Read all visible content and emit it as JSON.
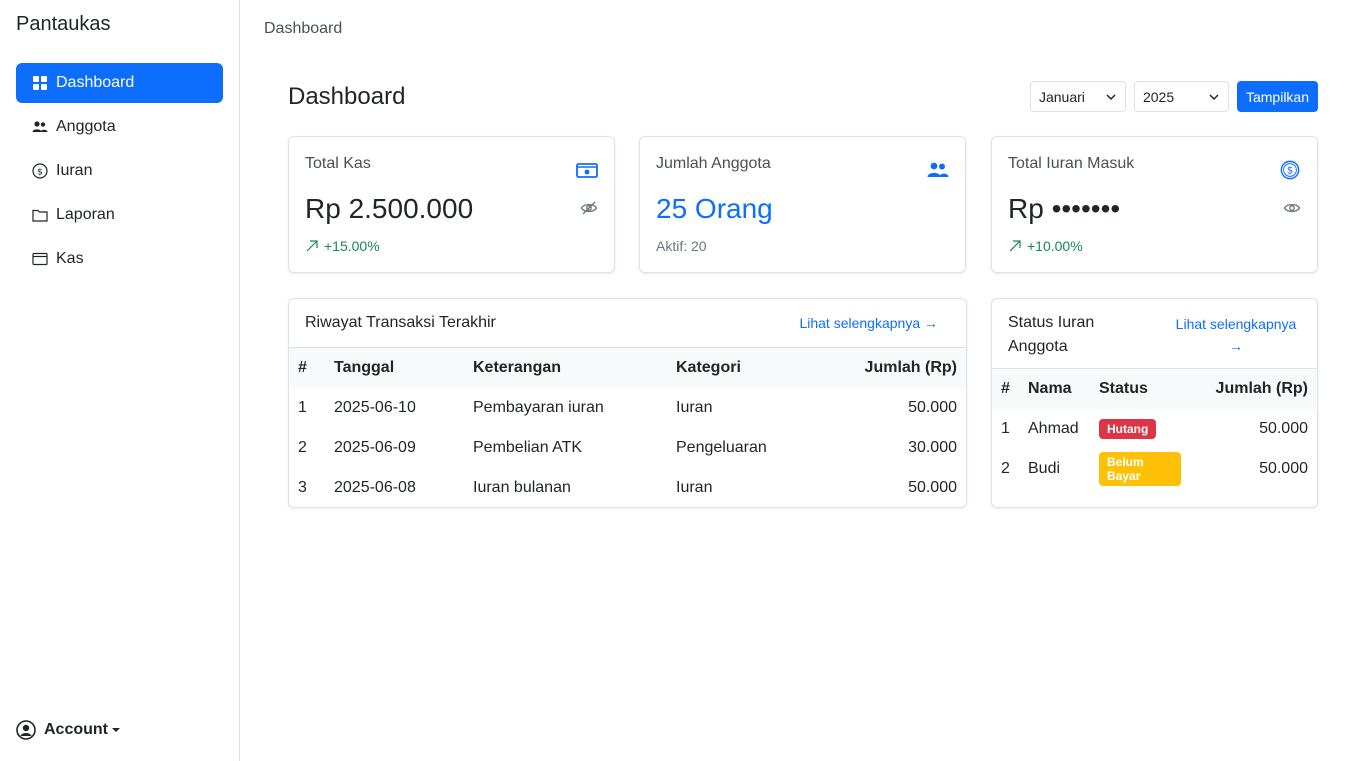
{
  "app": {
    "brand": "Pantaukas"
  },
  "sidebar": {
    "items": [
      {
        "label": "Dashboard",
        "icon": "grid-icon",
        "active": true
      },
      {
        "label": "Anggota",
        "icon": "people-icon"
      },
      {
        "label": "Iuran",
        "icon": "coin-icon"
      },
      {
        "label": "Laporan",
        "icon": "folder-icon"
      },
      {
        "label": "Kas",
        "icon": "wallet-icon"
      }
    ],
    "account_label": "Account"
  },
  "breadcrumb": "Dashboard",
  "page_title": "Dashboard",
  "filters": {
    "month": "Januari",
    "year": "2025",
    "submit_label": "Tampilkan"
  },
  "stats": {
    "total_kas": {
      "label": "Total Kas",
      "value": "Rp 2.500.000",
      "change": "+15.00%"
    },
    "anggota": {
      "label": "Jumlah Anggota",
      "value": "25 Orang",
      "sub": "Aktif: 20"
    },
    "iuran": {
      "label": "Total Iuran Masuk",
      "value": "Rp •••••••",
      "change": "+10.00%"
    }
  },
  "transactions": {
    "title": "Riwayat Transaksi Terakhir",
    "more_link": "Lihat selengkapnya →",
    "headers": [
      "#",
      "Tanggal",
      "Keterangan",
      "Kategori",
      "Jumlah (Rp)"
    ],
    "rows": [
      [
        "1",
        "2025-06-10",
        "Pembayaran iuran",
        "Iuran",
        "50.000"
      ],
      [
        "2",
        "2025-06-09",
        "Pembelian ATK",
        "Pengeluaran",
        "30.000"
      ],
      [
        "3",
        "2025-06-08",
        "Iuran bulanan",
        "Iuran",
        "50.000"
      ]
    ]
  },
  "member_status": {
    "title": "Status Iuran Anggota",
    "more_link": "Lihat selengkapnya →",
    "headers": [
      "#",
      "Nama",
      "Status",
      "Jumlah (Rp)"
    ],
    "rows": [
      [
        "1",
        "Ahmad",
        "Hutang",
        "50.000"
      ],
      [
        "2",
        "Budi",
        "Belum Bayar",
        "50.000"
      ]
    ]
  },
  "colors": {
    "primary": "#0d6efd",
    "success": "#198754",
    "danger": "#dc3545",
    "warning": "#ffc107"
  }
}
